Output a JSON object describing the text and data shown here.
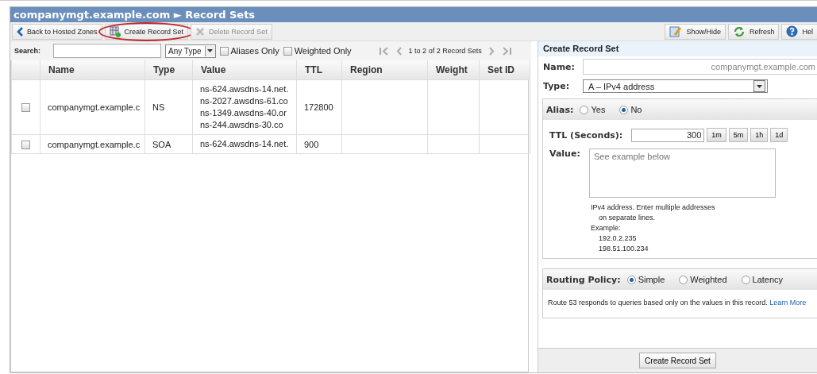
{
  "title": "companymgt.example.com ► Record Sets",
  "toolbar": {
    "left": [
      {
        "label": "Back to Hosted Zones",
        "kind": "back",
        "disabled": false,
        "highlighted": false
      },
      {
        "label": "Create Record Set",
        "kind": "create",
        "disabled": false,
        "highlighted": true
      },
      {
        "label": "Delete Record Set",
        "kind": "delete",
        "disabled": true,
        "highlighted": false
      }
    ],
    "right": [
      {
        "label": "Show/Hide",
        "kind": "showhide"
      },
      {
        "label": "Refresh",
        "kind": "refresh"
      },
      {
        "label": "Hel",
        "kind": "help"
      }
    ]
  },
  "search": {
    "label": "Search:"
  },
  "type_filter": {
    "value": "Any Type"
  },
  "filters": [
    {
      "label": "Aliases Only",
      "checked": false
    },
    {
      "label": "Weighted Only",
      "checked": false
    }
  ],
  "pager": {
    "text": "1 to 2 of 2 Record Sets"
  },
  "table": {
    "columns": [
      "Name",
      "Type",
      "Value",
      "TTL",
      "Region",
      "Weight",
      "Set ID"
    ],
    "rows": [
      {
        "checked": false,
        "name": "companymgt.example.c",
        "type": "NS",
        "value": [
          "ns-624.awsdns-14.net.",
          "ns-2027.awsdns-61.co",
          "ns-1349.awsdns-40.or",
          "ns-244.awsdns-30.co"
        ],
        "ttl": "172800"
      },
      {
        "checked": false,
        "name": "companymgt.example.c",
        "type": "SOA",
        "value": [
          "ns-624.awsdns-14.net."
        ],
        "ttl": "900"
      }
    ]
  },
  "form": {
    "title": "Create Record Set",
    "name": {
      "label": "Name:",
      "placeholder": "companymgt.example.com"
    },
    "type": {
      "label": "Type:",
      "value": "A – IPv4 address"
    },
    "alias": {
      "label": "Alias:",
      "options": [
        {
          "label": "Yes",
          "selected": false
        },
        {
          "label": "No",
          "selected": true
        }
      ]
    },
    "ttl": {
      "label": "TTL (Seconds):",
      "value": "300",
      "presets": [
        "1m",
        "5m",
        "1h",
        "1d"
      ]
    },
    "value": {
      "label": "Value:",
      "placeholder": "See example below",
      "help": [
        {
          "text": "IPv4 address. Enter multiple addresses",
          "children": [
            "on separate lines."
          ]
        },
        {
          "text": "Example:",
          "children": [
            "192.0.2.235",
            "198.51.100.234"
          ]
        }
      ]
    },
    "routing": {
      "label": "Routing Policy:",
      "options": [
        {
          "label": "Simple",
          "selected": true
        },
        {
          "label": "Weighted",
          "selected": false
        },
        {
          "label": "Latency",
          "selected": false
        }
      ],
      "description": "Route 53 responds to queries based only on the values in this record.",
      "link": "Learn More"
    },
    "submit": "Create Record Set"
  }
}
